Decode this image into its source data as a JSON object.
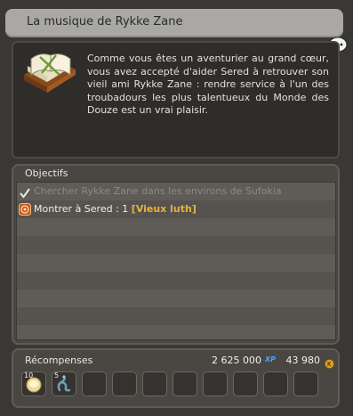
{
  "window": {
    "title": "La musique de Rykke Zane"
  },
  "quest": {
    "description": "Comme vous êtes un aventurier au grand cœur, vous avez accepté d'aider Sered à retrouver son vieil ami Rykke Zane : rendre service à l'un des troubadours les plus talentueux du Monde des Douze est un vrai plaisir.",
    "icon": "open-book-icon"
  },
  "objectives": {
    "header": "Objectifs",
    "items": [
      {
        "text": "Chercher Rykke Zane dans les environs de Sufokia",
        "status": "done",
        "icon": "checkmark-icon"
      },
      {
        "text_prefix": "Montrer à Sered : 1 ",
        "text_item": "[Vieux luth]",
        "status": "active",
        "icon": "target-icon"
      }
    ]
  },
  "rewards": {
    "header": "Récompenses",
    "xp": "2 625 000",
    "xp_icon": "XP",
    "kamas": "43 980",
    "items": [
      {
        "qty": "10",
        "icon": "bread-icon"
      },
      {
        "qty": "5",
        "icon": "serpent-icon"
      }
    ]
  },
  "colors": {
    "item_highlight": "#e6b23e",
    "done_text": "#8b8985",
    "xp_blue": "#4da3ff"
  }
}
